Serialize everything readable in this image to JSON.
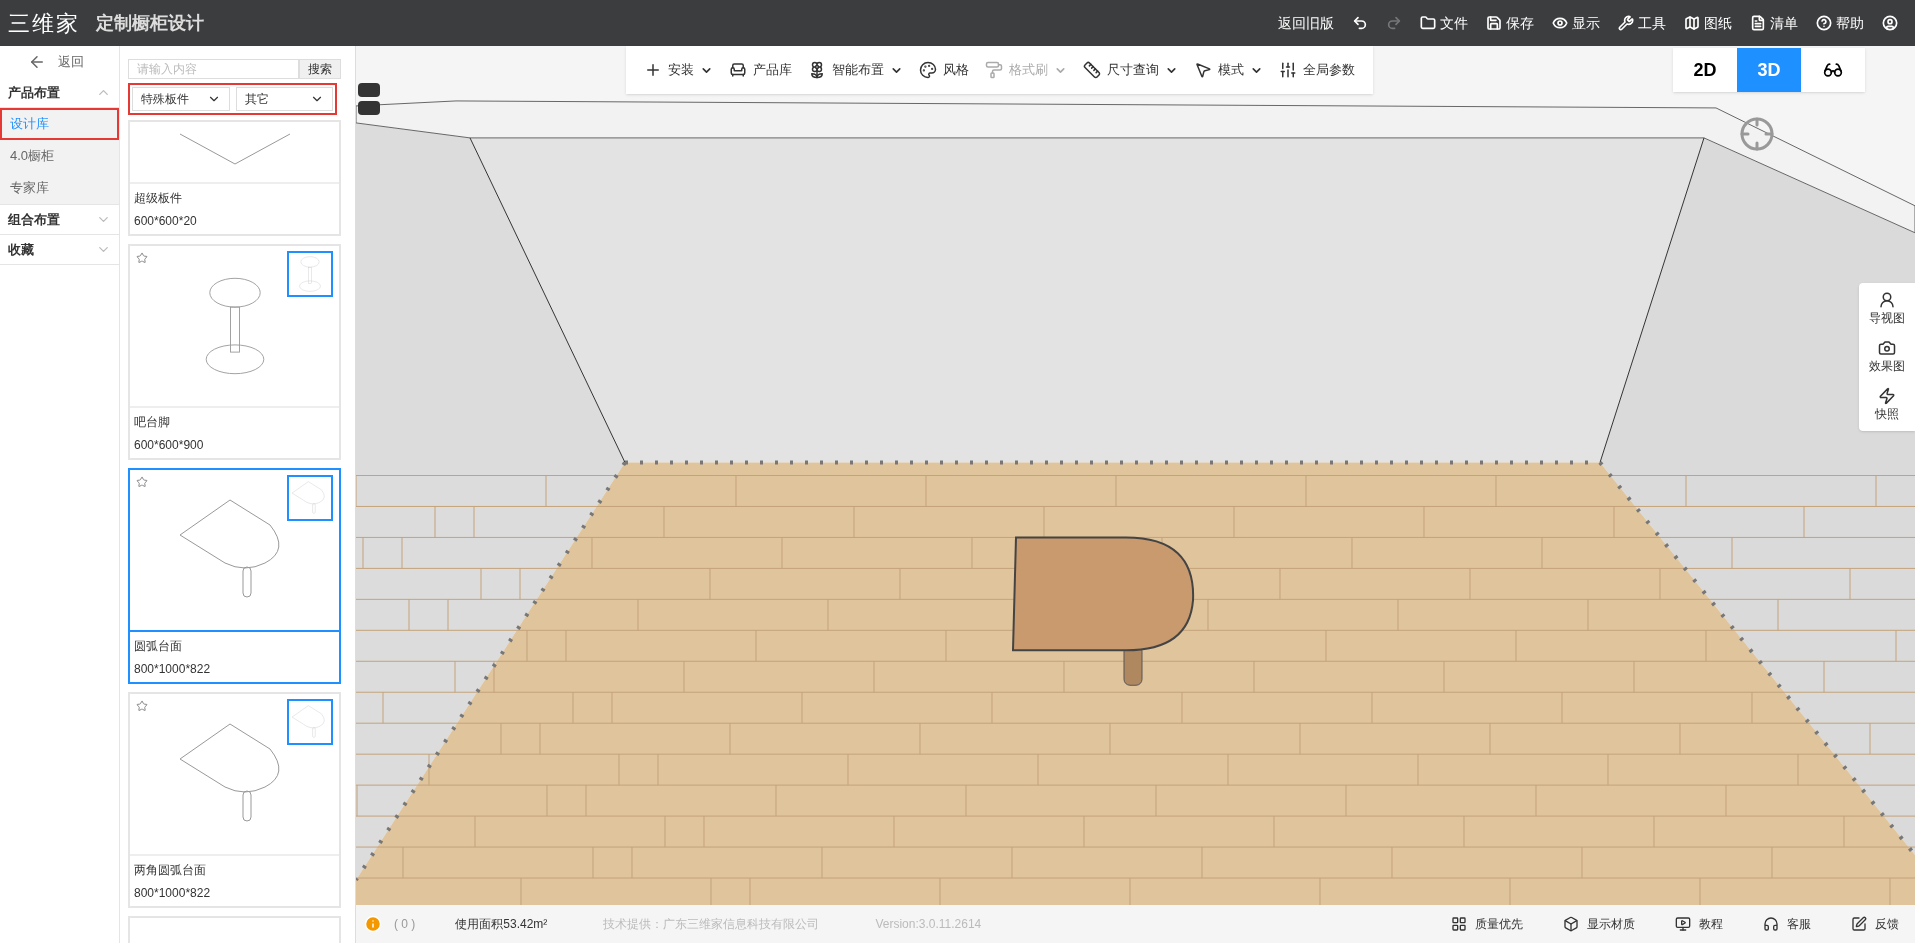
{
  "app": {
    "logo": "三维家",
    "title": "定制橱柜设计"
  },
  "menu": [
    {
      "kind": "text",
      "label": "返回旧版",
      "disabled": false
    },
    {
      "kind": "undo",
      "disabled": false
    },
    {
      "kind": "redo",
      "disabled": true
    },
    {
      "kind": "file",
      "label": "文件",
      "disabled": false
    },
    {
      "kind": "save",
      "label": "保存",
      "disabled": false
    },
    {
      "kind": "display",
      "label": "显示",
      "disabled": false
    },
    {
      "kind": "tools",
      "label": "工具",
      "disabled": false
    },
    {
      "kind": "drawings",
      "label": "图纸",
      "disabled": false
    },
    {
      "kind": "list",
      "label": "清单",
      "disabled": false
    },
    {
      "kind": "help",
      "label": "帮助",
      "disabled": false
    },
    {
      "kind": "user",
      "disabled": false
    }
  ],
  "nav": {
    "back": "返回",
    "sections": [
      {
        "label": "产品布置",
        "expanded": true,
        "children": [
          {
            "label": "设计库",
            "selected": true
          },
          {
            "label": "4.0橱柜",
            "selected": false
          },
          {
            "label": "专家库",
            "selected": false
          }
        ]
      },
      {
        "label": "组合布置",
        "expanded": false
      },
      {
        "label": "收藏",
        "expanded": false
      }
    ]
  },
  "search": {
    "placeholder": "请输入内容",
    "button": "搜索"
  },
  "filters": [
    {
      "value": "特殊板件"
    },
    {
      "value": "其它"
    }
  ],
  "products": [
    {
      "kind": "panel",
      "name": "超级板件",
      "size": "600*600*20",
      "selected": false
    },
    {
      "kind": "stool",
      "name": "吧台脚",
      "size": "600*600*900",
      "selected": false
    },
    {
      "kind": "arc",
      "name": "圆弧台面",
      "size": "800*1000*822",
      "selected": true
    },
    {
      "kind": "arc",
      "name": "两角圆弧台面",
      "size": "800*1000*822",
      "selected": false
    },
    {
      "kind": "board",
      "selected": false
    }
  ],
  "toolbar": [
    {
      "kind": "plus",
      "label": "安装",
      "dropdown": true,
      "disabled": false
    },
    {
      "kind": "chair",
      "label": "产品库",
      "dropdown": false,
      "disabled": false
    },
    {
      "kind": "plant",
      "label": "智能布置",
      "dropdown": true,
      "disabled": false
    },
    {
      "kind": "palette",
      "label": "风格",
      "dropdown": false,
      "disabled": false
    },
    {
      "kind": "roller",
      "label": "格式刷",
      "dropdown": true,
      "disabled": true
    },
    {
      "kind": "ruler",
      "label": "尺寸查询",
      "dropdown": true,
      "disabled": false
    },
    {
      "kind": "pointer",
      "label": "模式",
      "dropdown": true,
      "disabled": false
    },
    {
      "kind": "sliders",
      "label": "全局参数",
      "dropdown": false,
      "disabled": false
    }
  ],
  "views": [
    {
      "kind": "text",
      "label": "2D",
      "selected": false
    },
    {
      "kind": "text",
      "label": "3D",
      "selected": true
    },
    {
      "kind": "vr",
      "selected": false
    }
  ],
  "side_tools": [
    {
      "kind": "person",
      "label": "导视图"
    },
    {
      "kind": "camera",
      "label": "效果图"
    },
    {
      "kind": "flash",
      "label": "快照"
    }
  ],
  "status_bar": {
    "count": "( 0 )",
    "area": "使用面积53.42m²",
    "provider": "技术提供：广东三维家信息科技有限公司",
    "version": "Version:3.0.11.2614",
    "actions": [
      {
        "kind": "quality",
        "label": "质量优先"
      },
      {
        "kind": "cube",
        "label": "显示材质"
      },
      {
        "kind": "video",
        "label": "教程"
      },
      {
        "kind": "headset",
        "label": "客服"
      },
      {
        "kind": "edit",
        "label": "反馈"
      }
    ]
  }
}
